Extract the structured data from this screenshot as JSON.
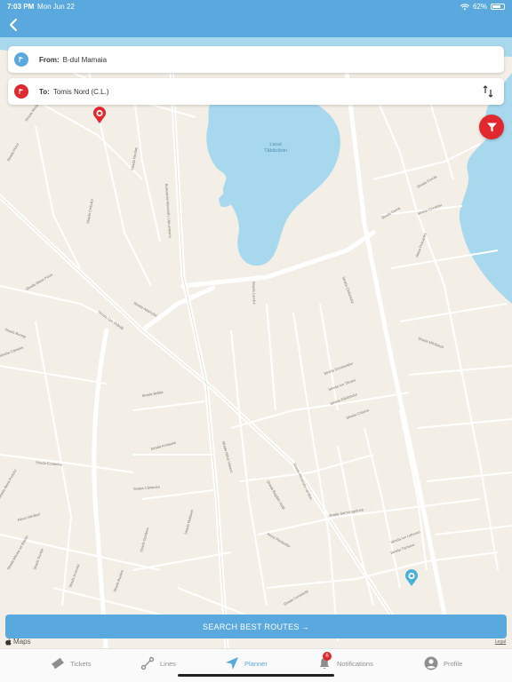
{
  "status": {
    "time": "7:03 PM",
    "date": "Mon Jun 22",
    "battery": "62%"
  },
  "nav": {
    "back_icon": "chevron-left-icon"
  },
  "route": {
    "from_label": "From:",
    "from_value": "B-dul Mamaia",
    "to_label": "To:",
    "to_value": "Tomis Nord (C.L.)"
  },
  "map": {
    "lake_label_1": "Lacul",
    "lake_label_2": "Tăbăcăriei",
    "streets": [
      "Strada Mușatini",
      "Strada Pictor",
      "Strada Cerbului",
      "Strada Nicolae",
      "Bulevardul Alexandru Lăpușneanu",
      "Strada Aleea Pictor",
      "Strada Cpt. Dobrilă",
      "Strada Adamclisi",
      "Strada Bucegi",
      "Strada Cișmelei",
      "Strada Lacului",
      "Strada Ciobanului",
      "Strada Ciucaș",
      "Strada Cerna",
      "Strada Ciocârliei",
      "Aleea Pescarilor",
      "Strada Mărășești",
      "Strada Dorobanților",
      "Strada Ion Țăranu",
      "Strada Răsăritului",
      "Strada Crișana",
      "Strada Câmpului",
      "Strada Brăilei",
      "Strada Arcașului",
      "Aleea Vânători",
      "Strada Ecaterina",
      "Strada Aleea Portului",
      "Strada Mircea cel Bătrân",
      "Strada Soveja",
      "Strada Izvorului",
      "Strada Busteni",
      "Strada Dunărea",
      "Strada Moldovei",
      "Strada Mihai Viteazu",
      "Strada Bogdan Vodă",
      "Strada Alexandru cel Bun",
      "Strada Sarmizegetusa",
      "Strada Ion Lahovari",
      "Strada Tișmana",
      "Aleea Pandurilor",
      "Strada Constanța"
    ]
  },
  "colors": {
    "primary": "#5aa9de",
    "accent": "#e0282e",
    "water": "#a7d8ee",
    "land": "#f3efe6"
  },
  "search_button": "SEARCH BEST ROUTES",
  "search_arrow": "→",
  "attribution": {
    "maps": "Maps",
    "legal": "Legal"
  },
  "tabs": [
    {
      "label": "Tickets",
      "icon": "ticket-icon"
    },
    {
      "label": "Lines",
      "icon": "route-icon"
    },
    {
      "label": "Planner",
      "icon": "navigation-arrow-icon"
    },
    {
      "label": "Notifications",
      "icon": "bell-icon",
      "badge": "6"
    },
    {
      "label": "Profile",
      "icon": "person-icon"
    }
  ]
}
